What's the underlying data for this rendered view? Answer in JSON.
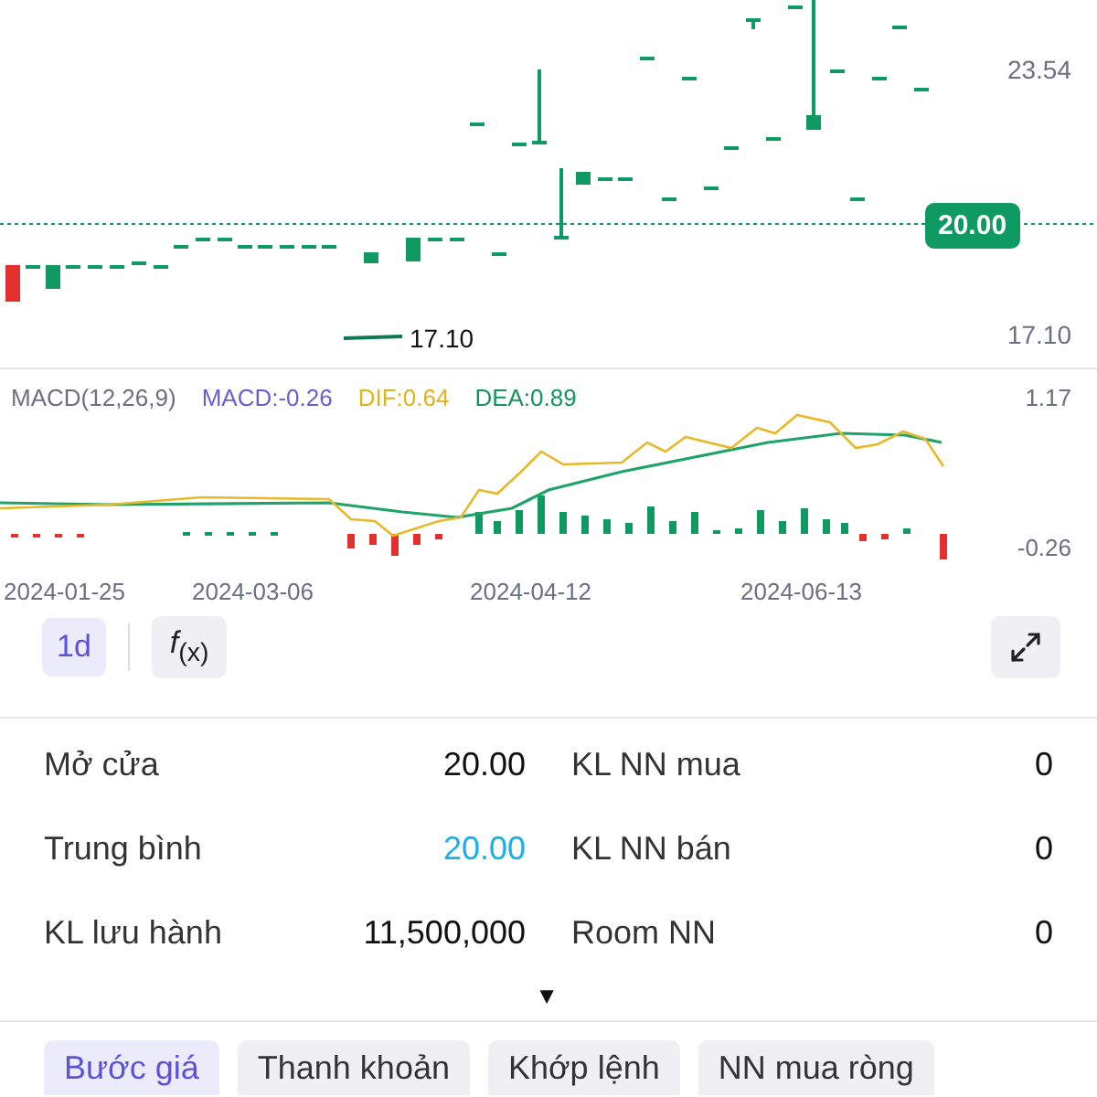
{
  "price_chart": {
    "y_ticks": [
      "23.54",
      "17.10"
    ],
    "last_price": "20.00",
    "low_marker": "17.10"
  },
  "macd": {
    "title": "MACD(12,26,9)",
    "macd": "MACD:-0.26",
    "dif": "DIF:0.64",
    "dea": "DEA:0.89",
    "y_ticks": [
      "1.17",
      "-0.26"
    ]
  },
  "dates": [
    "2024-01-25",
    "2024-03-06",
    "2024-04-12",
    "2024-06-13"
  ],
  "toolbar": {
    "interval": {
      "label": "1d",
      "selected": true
    },
    "indicator": "*f*$_{(x)}$"
  },
  "stats": [
    {
      "label": "Mở cửa",
      "value": "20.00",
      "color": "#111111"
    },
    {
      "label": "KL NN mua",
      "value": "0",
      "color": "#111111"
    },
    {
      "label": "Trung bình",
      "value": "20.00",
      "color": "#1ab0e8"
    },
    {
      "label": "KL NN bán",
      "value": "0",
      "color": "#111111"
    },
    {
      "label": "KL lưu hành",
      "value": "11,500,000",
      "color": "#111111"
    },
    {
      "label": "Room NN",
      "value": "0",
      "color": "#111111"
    }
  ],
  "expand_toggle": "▼",
  "tabs": [
    {
      "label": "Bước giá",
      "selected": true
    },
    {
      "label": "Thanh khoản",
      "selected": false
    },
    {
      "label": "Khớp lệnh",
      "selected": false
    },
    {
      "label": "NN mua ròng",
      "selected": false
    }
  ]
}
